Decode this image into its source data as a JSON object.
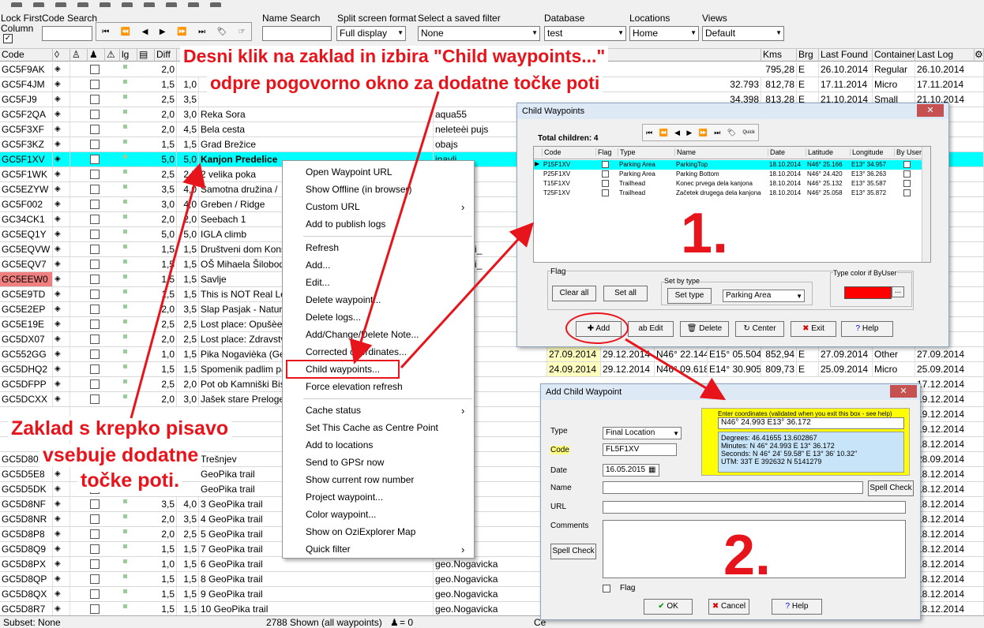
{
  "toolbar": {
    "lock_first_column": "Lock First",
    "column": "Column",
    "code_search": "Code Search",
    "name_search": "Name Search",
    "split_screen_format": "Split screen format",
    "split_value": "Full display",
    "saved_filter": "Select a saved filter",
    "filter_value": "None",
    "database": "Database",
    "database_value": "test",
    "locations": "Locations",
    "locations_value": "Home",
    "views": "Views",
    "views_value": "Default",
    "nav": [
      "⏮",
      "⏪",
      "◀",
      "▶",
      "⏩",
      "⏭",
      "🏷",
      "☞"
    ]
  },
  "grid": {
    "headers": {
      "code": "Code",
      "lg": "lg",
      "diff": "Diff",
      "kms": "Kms",
      "brg": "Brg",
      "last_found": "Last Found",
      "container": "Container",
      "last_log": "Last Log"
    },
    "rows": [
      {
        "code": "GC5F9AK",
        "diff": "2,0",
        "terr": "",
        "name": "",
        "placer": "",
        "coords": "",
        "kms": "795,28",
        "brg": "E",
        "last_found": "26.10.2014",
        "container": "Regular",
        "last_log": "26.10.2014"
      },
      {
        "code": "GC5F4JM",
        "diff": "1,5",
        "terr": "1,0",
        "name": "",
        "placer": "",
        "coords": "32.793",
        "kms": "812,78",
        "brg": "E",
        "last_found": "17.11.2014",
        "container": "Micro",
        "last_log": "17.11.2014"
      },
      {
        "code": "GC5FJ9",
        "diff": "2,5",
        "terr": "3,5",
        "name": "",
        "placer": "",
        "coords": "34.398",
        "kms": "813,28",
        "brg": "E",
        "last_found": "21.10.2014",
        "container": "Small",
        "last_log": "21.10.2014"
      },
      {
        "code": "GC5F2QA",
        "diff": "2,0",
        "terr": "3,0",
        "name": "Reka Sora",
        "placer": "aqua55",
        "last_log": "2014"
      },
      {
        "code": "GC5F3XF",
        "diff": "2,0",
        "terr": "4,5",
        "name": "Bela cesta",
        "placer": "neleteèi pujs",
        "last_log": "2014"
      },
      {
        "code": "GC5F3KZ",
        "diff": "1,5",
        "terr": "1,5",
        "name": "Grad Brežice",
        "placer": "obajs",
        "last_log": "2014"
      },
      {
        "code": "GC5F1XV",
        "diff": "5,0",
        "terr": "5,0",
        "name": "Kanjon Predelice",
        "placer": "inavli",
        "last_log": "2014"
      },
      {
        "code": "GC5F1WK",
        "diff": "2,5",
        "terr": "2,5",
        "name": "2 velika poka",
        "placer": "",
        "last_log": "2014"
      },
      {
        "code": "GC5EZYW",
        "diff": "3,5",
        "terr": "4,0",
        "name": "Samotna družina /",
        "placer": "",
        "last_log": "2014"
      },
      {
        "code": "GC5F002",
        "diff": "3,0",
        "terr": "4,0",
        "name": "Greben / Ridge",
        "placer": "",
        "last_log": "2014"
      },
      {
        "code": "GC34CK1",
        "diff": "2,0",
        "terr": "2,0",
        "name": "Seebach 1",
        "placer": "",
        "last_log": "2014"
      },
      {
        "code": "GC5EQ1Y",
        "diff": "5,0",
        "terr": "5,0",
        "name": "IGLA climb",
        "placer": "damjanja",
        "last_log": "2014"
      },
      {
        "code": "GC5EQVW",
        "diff": "1,5",
        "terr": "1,5",
        "name": "Društveni dom Konš",
        "placer": "ane, Nicci_",
        "last_log": "2014"
      },
      {
        "code": "GC5EQV7",
        "diff": "1,5",
        "terr": "1,5",
        "name": "OŠ Mihaela Šiloboda",
        "placer": "ane, Nicci_",
        "last_log": "2014"
      },
      {
        "code": "GC5EEW0",
        "diff": "1,5",
        "terr": "1,5",
        "name": "Savlje",
        "placer": "sam",
        "last_log": "2014"
      },
      {
        "code": "GC5E9TD",
        "diff": "1,5",
        "terr": "1,5",
        "name": "This is NOT Real Le",
        "placer": "",
        "last_log": "2014"
      },
      {
        "code": "GC5E2EP",
        "diff": "2,0",
        "terr": "3,5",
        "name": "Slap Pasjak - Natura",
        "placer": "alpinus",
        "last_log": "2014"
      },
      {
        "code": "GC5E19E",
        "diff": "2,5",
        "terr": "2,5",
        "name": "Lost place: Opušèen",
        "placer": "",
        "last_log": "2014"
      },
      {
        "code": "GC5DX07",
        "diff": "2,0",
        "terr": "2,5",
        "name": "Lost place: Zdravstv",
        "placer": "",
        "last_log": "2014"
      },
      {
        "code": "GC552GG",
        "diff": "1,0",
        "terr": "1,5",
        "name": "Pika Nogavièka (Ge",
        "placer": "avicka",
        "placed": "27.09.2014",
        "updated": "29.12.2014",
        "lat": "N46° 22.144",
        "lon": "E15° 05.504",
        "kms": "852,94",
        "brg": "E",
        "last_found": "27.09.2014",
        "container": "Other",
        "last_log": "27.09.2014"
      },
      {
        "code": "GC5DHQ2",
        "diff": "1,5",
        "terr": "1,5",
        "name": "Spomenik padlim par",
        "placer": "avicka",
        "placed": "24.09.2014",
        "updated": "29.12.2014",
        "lat": "N46° 09.618",
        "lon": "E14° 30.905",
        "kms": "809,73",
        "brg": "E",
        "last_found": "25.09.2014",
        "container": "Micro",
        "last_log": "25.09.2014"
      },
      {
        "code": "GC5DFPP",
        "diff": "2,5",
        "terr": "2,0",
        "name": "Pot ob Kamniški Bist",
        "placer": "",
        "last_log": "17.12.2014"
      },
      {
        "code": "GC5DCXX",
        "diff": "2,0",
        "terr": "3,0",
        "name": "Jašek stare Preloge",
        "placer": "an",
        "last_log": "19.12.2014"
      },
      {
        "code": "",
        "diff": "",
        "terr": "",
        "name": "",
        "placer": "",
        "last_log": "19.12.2014"
      },
      {
        "code": "",
        "diff": "",
        "terr": "",
        "name": "",
        "placer": "",
        "last_log": "19.12.2014"
      },
      {
        "code": "",
        "diff": "",
        "terr": "",
        "name": "",
        "placer": "",
        "last_log": "18.12.2014"
      },
      {
        "code": "GC5D801",
        "diff": "",
        "terr": "",
        "name": "Trešnjev",
        "placer": "ass",
        "last_log": "28.09.2014"
      },
      {
        "code": "GC5D5E8",
        "diff": "",
        "terr": "",
        "name": "GeoPika trail",
        "placer": "avicka",
        "last_log": "18.12.2014"
      },
      {
        "code": "GC5D5DK",
        "diff": "",
        "terr": "",
        "name": "GeoPika trail",
        "placer": "avicka",
        "last_log": "18.12.2014"
      },
      {
        "code": "GC5D8NF",
        "diff": "3,5",
        "terr": "4,0",
        "name": "3 GeoPika trail",
        "placer": "avicka",
        "last_log": "18.12.2014"
      },
      {
        "code": "GC5D8NR",
        "diff": "2,0",
        "terr": "3,5",
        "name": "4 GeoPika trail",
        "placer": "avicka",
        "last_log": "18.12.2014"
      },
      {
        "code": "GC5D8P8",
        "diff": "2,0",
        "terr": "2,5",
        "name": "5 GeoPika trail",
        "placer": "avicka",
        "last_log": "18.12.2014"
      },
      {
        "code": "GC5D8Q9",
        "diff": "1,5",
        "terr": "1,5",
        "name": "7 GeoPika trail",
        "placer": "avicka",
        "last_log": "18.12.2014"
      },
      {
        "code": "GC5D8PX",
        "diff": "1,0",
        "terr": "1,5",
        "name": "6 GeoPika trail",
        "placer": "geo.Nogavicka",
        "last_log": "18.12.2014"
      },
      {
        "code": "GC5D8QP",
        "diff": "1,5",
        "terr": "1,5",
        "name": "8 GeoPika trail",
        "placer": "geo.Nogavicka",
        "last_log": "18.12.2014"
      },
      {
        "code": "GC5D8QX",
        "diff": "1,5",
        "terr": "1,5",
        "name": "9 GeoPika trail",
        "placer": "geo.Nogavicka",
        "last_log": "18.12.2014"
      },
      {
        "code": "GC5D8R7",
        "diff": "1,5",
        "terr": "1,5",
        "name": "10 GeoPika trail",
        "placer": "geo.Nogavicka",
        "last_log": "18.12.2014"
      }
    ]
  },
  "status_bar": {
    "subset": "Subset: None",
    "shown": "2788 Shown (all waypoints)",
    "user_count": "= 0",
    "ce": "Ce"
  },
  "context_menu": {
    "items": [
      "Open Waypoint URL",
      "Show Offline (in browser)",
      "Custom URL",
      "Add to publish logs",
      "Refresh",
      "Add...",
      "Edit...",
      "Delete waypoint...",
      "Delete logs...",
      "Add/Change/Delete Note...",
      "Corrected coordinates...",
      "Child waypoints...",
      "Force elevation refresh",
      "Cache status",
      "Set This Cache as Centre Point",
      "Add to locations",
      "Send to GPSr now",
      "Show current row number",
      "Project waypoint...",
      "Color waypoint...",
      "Show on OziExplorer Map",
      "Quick filter"
    ]
  },
  "child_dialog": {
    "title": "Child Waypoints",
    "total_children": "Total children: 4",
    "headers": [
      "Code",
      "Flag",
      "Type",
      "Name",
      "Date",
      "Latitude",
      "Longitude",
      "By User"
    ],
    "rows": [
      [
        "P15F1XV",
        "",
        "Parking Area",
        "ParkingTop",
        "18.10.2014",
        "N46° 25.166",
        "E13° 34.957",
        ""
      ],
      [
        "P25F1XV",
        "",
        "Parking Area",
        "Parking Bottom",
        "18.10.2014",
        "N46° 24.420",
        "E13° 36.263",
        ""
      ],
      [
        "T15F1XV",
        "",
        "Trailhead",
        "Konec prvega dela kanjona",
        "18.10.2014",
        "N46° 25.132",
        "E13° 35.587",
        ""
      ],
      [
        "T25F1XV",
        "",
        "Trailhead",
        "Začetek drugega dela kanjona",
        "18.10.2014",
        "N46° 25.058",
        "E13° 35.872",
        ""
      ]
    ],
    "flag_group": "Flag",
    "clear_all": "Clear all",
    "set_all": "Set all",
    "set_by_type_group": "Set by type",
    "set_type": "Set type",
    "type_value": "Parking Area",
    "type_color_group": "Type color if ByUser",
    "type_color": "#ff0000",
    "color_btn": "...",
    "add": "Add",
    "edit": "Edit",
    "delete": "Delete",
    "center": "Center",
    "exit": "Exit",
    "help": "Help",
    "close": "✕",
    "quick": "Quick"
  },
  "add_dialog": {
    "title": "Add Child Waypoint",
    "type_label": "Type",
    "type_value": "Final Location",
    "code_label": "Code",
    "code_value": "FL5F1XV",
    "date_label": "Date",
    "date_value": "16.05.2015",
    "name_label": "Name",
    "url_label": "URL",
    "comments_label": "Comments",
    "spell_check": "Spell Check",
    "flag_label": "Flag",
    "coords_title": "Enter coordinates (validated when you exit this box - see help)",
    "coords_input": "N46° 24.993  E13° 36.172",
    "coords_info": [
      "Degrees:  46.41655  13.602867",
      "Minutes:  N 46° 24.993  E 13° 36.172",
      "Seconds:  N 46° 24' 59.58\"  E 13° 36' 10.32\"",
      "UTM:  33T  E 392632  N 5141279"
    ],
    "ok": "OK",
    "cancel": "Cancel",
    "help": "Help",
    "close": "✕"
  },
  "annotations": {
    "top_line1": "Desni klik na zaklad in izbira \"Child waypoints...\"",
    "top_line2": "odpre pogovorno okno za dodatne točke poti",
    "bottom_line1": "Zaklad s krepko pisavo",
    "bottom_line2": "vsebuje dodatne",
    "bottom_line3": "točke poti.",
    "num1": "1.",
    "num2": "2.",
    "red": "#e8141b"
  }
}
